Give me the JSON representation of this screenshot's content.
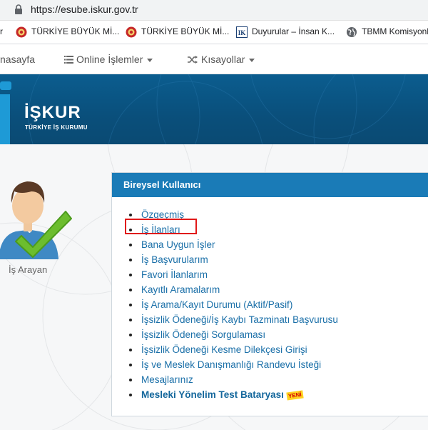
{
  "browser": {
    "url": "https://esube.iskur.gov.tr",
    "bookmarks": [
      {
        "label": "r",
        "icon": "none"
      },
      {
        "label": "TÜRKİYE BÜYÜK Mİ...",
        "icon": "tbmm-seal-icon"
      },
      {
        "label": "TÜRKİYE BÜYÜK Mİ...",
        "icon": "tbmm-seal-icon"
      },
      {
        "label": "Duyurular – İnsan K...",
        "icon": "ik-icon"
      },
      {
        "label": "TBMM Komisyonl",
        "icon": "globe-icon"
      }
    ]
  },
  "nav": {
    "home": "nasayfa",
    "online": "Online İşlemler",
    "shortcuts": "Kısayollar"
  },
  "banner": {
    "title": "İŞKUR",
    "subtitle": "TÜRKİYE İŞ KURUMU"
  },
  "profile": {
    "caption": "İş Arayan"
  },
  "panel": {
    "title": "Bireysel Kullanıcı",
    "items": [
      "Özgeçmiş",
      "İş İlanları",
      "Bana Uygun İşler",
      "İş Başvurularım",
      "Favori İlanlarım",
      "Kayıtlı Aramalarım",
      "İş Arama/Kayıt Durumu (Aktif/Pasif)",
      "İşsizlik Ödeneği/İş Kaybı Tazminatı Başvurusu",
      "İşsizlik Ödeneği Sorgulaması",
      "İşsizlik Ödeneği Kesme Dilekçesi Girişi",
      "İş ve Meslek Danışmanlığı Randevu İsteği",
      "Mesajlarınız",
      "Mesleki Yönelim Test Bataryası"
    ],
    "new_badge": "YENİ"
  }
}
